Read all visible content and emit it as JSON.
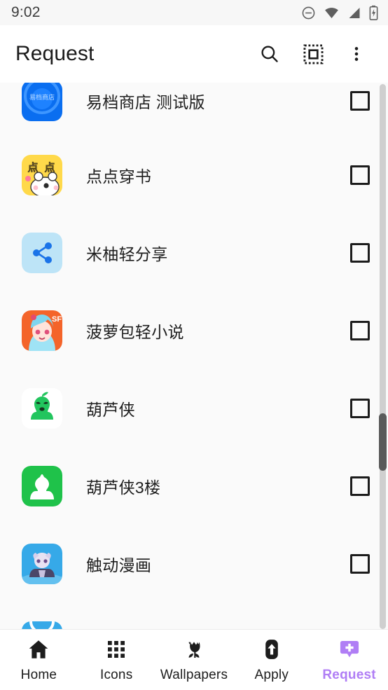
{
  "status_bar": {
    "time": "9:02",
    "icons": [
      "do-not-disturb-icon",
      "wifi-icon",
      "cellular-signal-icon",
      "battery-charging-icon"
    ]
  },
  "app_bar": {
    "title": "Request",
    "actions": [
      {
        "name": "search-icon",
        "label": "Search"
      },
      {
        "name": "select-all-icon",
        "label": "Select all"
      },
      {
        "name": "overflow-menu-icon",
        "label": "More options"
      }
    ]
  },
  "list": {
    "items": [
      {
        "label": "易档商店 测试版",
        "icon": "yidang-store-icon",
        "checked": false
      },
      {
        "label": "点点穿书",
        "icon": "diandian-chuanshu-icon",
        "checked": false
      },
      {
        "label": "米柚轻分享",
        "icon": "miyou-share-icon",
        "checked": false
      },
      {
        "label": "菠萝包轻小说",
        "icon": "boluobao-novel-icon",
        "checked": false
      },
      {
        "label": "葫芦侠",
        "icon": "huluxia-icon",
        "checked": false
      },
      {
        "label": "葫芦侠3楼",
        "icon": "huluxia-3lou-icon",
        "checked": false
      },
      {
        "label": "触动漫画",
        "icon": "chudong-comic-icon",
        "checked": false
      },
      {
        "label": "",
        "icon": "partial-blue-icon",
        "checked": false
      }
    ]
  },
  "bottom_nav": {
    "active_color": "#b07ef5",
    "items": [
      {
        "label": "Home",
        "icon": "home-icon",
        "active": false
      },
      {
        "label": "Icons",
        "icon": "grid-icon",
        "active": false
      },
      {
        "label": "Wallpapers",
        "icon": "tulip-icon",
        "active": false
      },
      {
        "label": "Apply",
        "icon": "apply-arrow-icon",
        "active": false
      },
      {
        "label": "Request",
        "icon": "request-bubble-plus-icon",
        "active": true
      }
    ]
  }
}
